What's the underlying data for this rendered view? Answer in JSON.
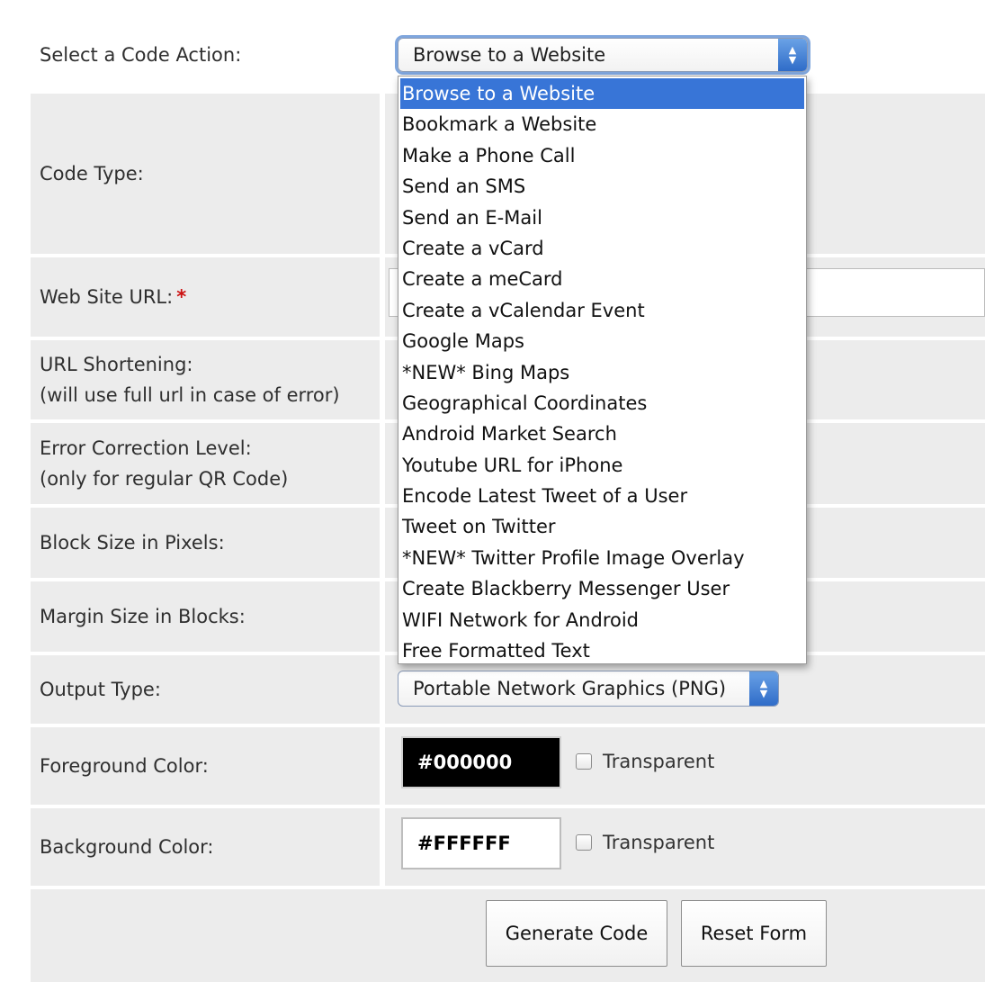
{
  "form": {
    "code_action": {
      "label": "Select a Code Action:",
      "selected": "Browse to a Website",
      "options": [
        "Browse to a Website",
        "Bookmark a Website",
        "Make a Phone Call",
        "Send an SMS",
        "Send an E-Mail",
        "Create a vCard",
        "Create a meCard",
        "Create a vCalendar Event",
        "Google Maps",
        "*NEW* Bing Maps",
        "Geographical Coordinates",
        "Android Market Search",
        "Youtube URL for iPhone",
        "Encode Latest Tweet of a User",
        "Tweet on Twitter",
        "*NEW* Twitter Profile Image Overlay",
        "Create Blackberry Messenger User",
        "WIFI Network for Android",
        "Free Formatted Text"
      ]
    },
    "code_type": {
      "label": "Code Type:"
    },
    "website_url": {
      "label": "Web Site URL:",
      "required_marker": "*",
      "value": ""
    },
    "url_shortening": {
      "label_line1": "URL Shortening:",
      "label_line2": "(will use full url in case of error)"
    },
    "error_correction": {
      "label_line1": "Error Correction Level:",
      "label_line2": "(only for regular QR Code)"
    },
    "block_size": {
      "label": "Block Size in Pixels:"
    },
    "margin_size": {
      "label": "Margin Size in Blocks:"
    },
    "output_type": {
      "label": "Output Type:",
      "selected": "Portable Network Graphics (PNG)"
    },
    "foreground_color": {
      "label": "Foreground Color:",
      "value": "#000000",
      "transparent_label": "Transparent"
    },
    "background_color": {
      "label": "Background Color:",
      "value": "#FFFFFF",
      "transparent_label": "Transparent"
    },
    "buttons": {
      "generate": "Generate Code",
      "reset": "Reset Form"
    }
  },
  "colors": {
    "row_background": "#ececec",
    "dropdown_highlight": "#3875d7",
    "required_marker": "#cc1111"
  }
}
